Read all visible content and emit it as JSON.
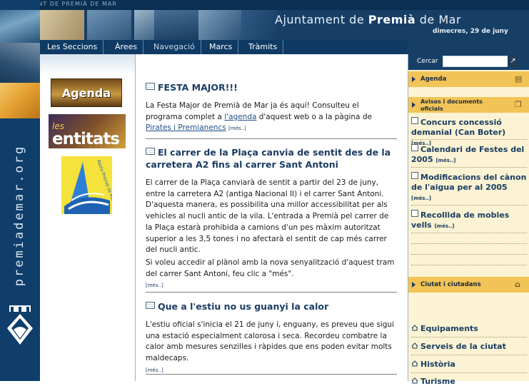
{
  "header": {
    "top_text": "AJUNTAMENT DE PREMIÀ DE MAR",
    "title_prefix": "Ajuntament de ",
    "title_bold": "Premià",
    "title_suffix": " de Mar",
    "date": "dimecres, 29 de juny",
    "vertical_text": "premiademar.org"
  },
  "nav": {
    "items": [
      "Les Seccions",
      "Àrees",
      "Navegació",
      "Marcs",
      "Tràmits"
    ]
  },
  "search": {
    "label": "Cercar",
    "value": "",
    "button": "↗"
  },
  "left": {
    "agenda": "Agenda",
    "entitats_les": "les",
    "entitats_word": "entitats",
    "radio_text": "Ràdio Premià de Mar"
  },
  "articles": [
    {
      "title": "FESTA MAJOR!!!",
      "body_pre": "La Festa Major de Premià de Mar ja és aquí! Consulteu el programa complet a ",
      "link1": "l'agenda",
      "body_mid": " d'aquest web o a la pàgina de ",
      "link2": "Pirates i Premianencs",
      "more": "[més..]"
    },
    {
      "title": "El carrer de la Plaça canvia de sentit des de la carretera A2 fins al carrer Sant Antoni",
      "body1": "El carrer de la Plaça canviarà de sentit a partir del 23 de juny, entre la carretera A2 (antiga Nacional II) i el carrer Sant Antoni. D'aquesta manera, es possibilita una millor accessibilitat per als vehicles al nucli antic de la vila. L'entrada a Premià pel carrer de la Plaça estarà prohibida a camions d'un pes màxim autoritzat superior a les 3,5 tones i no afectarà el sentit de cap més carrer del nucli antic.",
      "body2": "Si voleu accedir al plànol amb la nova senyalització d'aquest tram del carrer Sant Antoni, feu clic a \"més\".",
      "more": "[més..]"
    },
    {
      "title": "Que a l'estiu no us guanyi la calor",
      "body1": "L'estiu oficial s'inicia el 21 de juny i, enguany, es preveu que sigui una estació especialment calorosa i seca. Recordeu combatre la calor amb mesures senzilles i ràpides que ens poden evitar molts maldecaps.",
      "more": "[més..]"
    }
  ],
  "right": {
    "agenda": "Agenda",
    "avisos": "Avisos i documents oficials",
    "avisos_items": [
      {
        "text": "Concurs concessió demanial (Can Boter)",
        "more": "[més..]"
      },
      {
        "text": "Calendari de Festes del 2005",
        "more": "[més..]"
      },
      {
        "text": "Modificacions del cànon de l'aigua per al 2005",
        "more": "[més..]"
      },
      {
        "text": "Recollida de mobles vells",
        "more": "[més..]"
      }
    ],
    "ciutat": "Ciutat i ciutadans",
    "ciutat_items": [
      "Equipaments",
      "Serveis de la ciutat",
      "Història",
      "Turisme"
    ]
  }
}
